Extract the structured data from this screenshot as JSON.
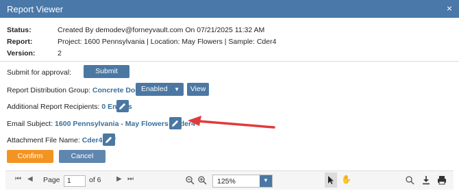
{
  "window": {
    "title": "Report Viewer",
    "close_glyph": "×"
  },
  "info": {
    "status_label": "Status:",
    "status_value": "Created By demodev@forneyvault.com On 07/21/2025 11:32 AM",
    "report_label": "Report:",
    "report_value": "Project: 1600 Pennsylvania | Location: May Flowers | Sample: Cder4",
    "version_label": "Version:",
    "version_value": "2"
  },
  "form": {
    "submit_label": "Submit for approval:",
    "submit_button": "Submit",
    "distribution_label": "Report Distribution Group:",
    "distribution_group": "Concrete Doctors",
    "distribution_select": "Enabled",
    "view_button": "View",
    "recipients_label": "Additional Report Recipients:",
    "recipients_value": "0 Entries",
    "email_subject_label": "Email Subject:",
    "email_subject_value": "1600 Pennsylvania - May Flowers - Cder4",
    "attachment_label": "Attachment File Name:",
    "attachment_value": "Cder4.pdf",
    "confirm_button": "Confirm",
    "cancel_button": "Cancel"
  },
  "toolbar": {
    "page_label": "Page",
    "page_value": "1",
    "page_total": "of 6",
    "zoom_value": "125%",
    "icons": [
      "first-page-icon",
      "prev-page-icon",
      "next-page-icon",
      "last-page-icon",
      "zoom-out-icon",
      "zoom-in-icon",
      "select-pointer-icon",
      "pan-hand-icon",
      "search-icon",
      "download-icon",
      "print-icon"
    ]
  },
  "colors": {
    "titlebar": "#4a78a8",
    "primary_button": "#4b77a3",
    "confirm_button": "#f39422",
    "link": "#3a6e9b",
    "annotation_arrow": "#e23a3a"
  }
}
